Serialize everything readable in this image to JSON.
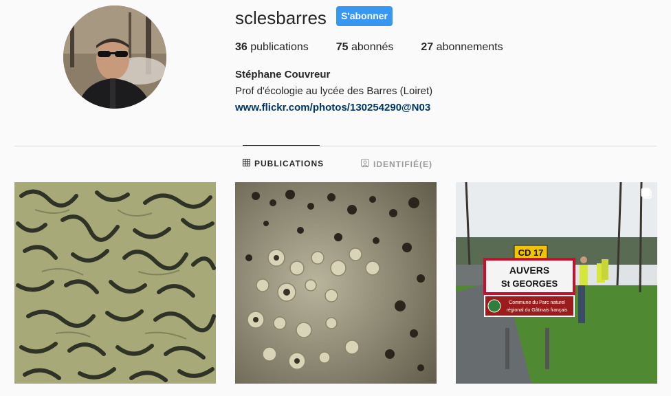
{
  "profile": {
    "username": "sclesbarres",
    "follow_label": "S'abonner",
    "full_name": "Stéphane Couvreur",
    "bio": "Prof d'écologie au lycée des Barres (Loiret)",
    "website": "www.flickr.com/photos/130254290@N03"
  },
  "stats": {
    "posts_count": "36",
    "posts_label": "publications",
    "followers_count": "75",
    "followers_label": "abonnés",
    "following_count": "27",
    "following_label": "abonnements"
  },
  "tabs": {
    "posts_label": "PUBLICATIONS",
    "tagged_label": "IDENTIFIÉ(E)"
  },
  "posts": {
    "sign_route": "CD 17",
    "sign_town_line1": "AUVERS",
    "sign_town_line2": "St GEORGES",
    "sign_sub_line1": "Commune du Parc naturel",
    "sign_sub_line2": "régional du Gâtinais français"
  },
  "colors": {
    "accent": "#3897f0",
    "link": "#003569",
    "text": "#262626",
    "muted": "#999999",
    "background": "#fafafa"
  },
  "icons": {
    "posts_tab": "grid-icon",
    "tagged_tab": "tagged-person-icon",
    "multi_post": "multiple-photos-icon"
  }
}
